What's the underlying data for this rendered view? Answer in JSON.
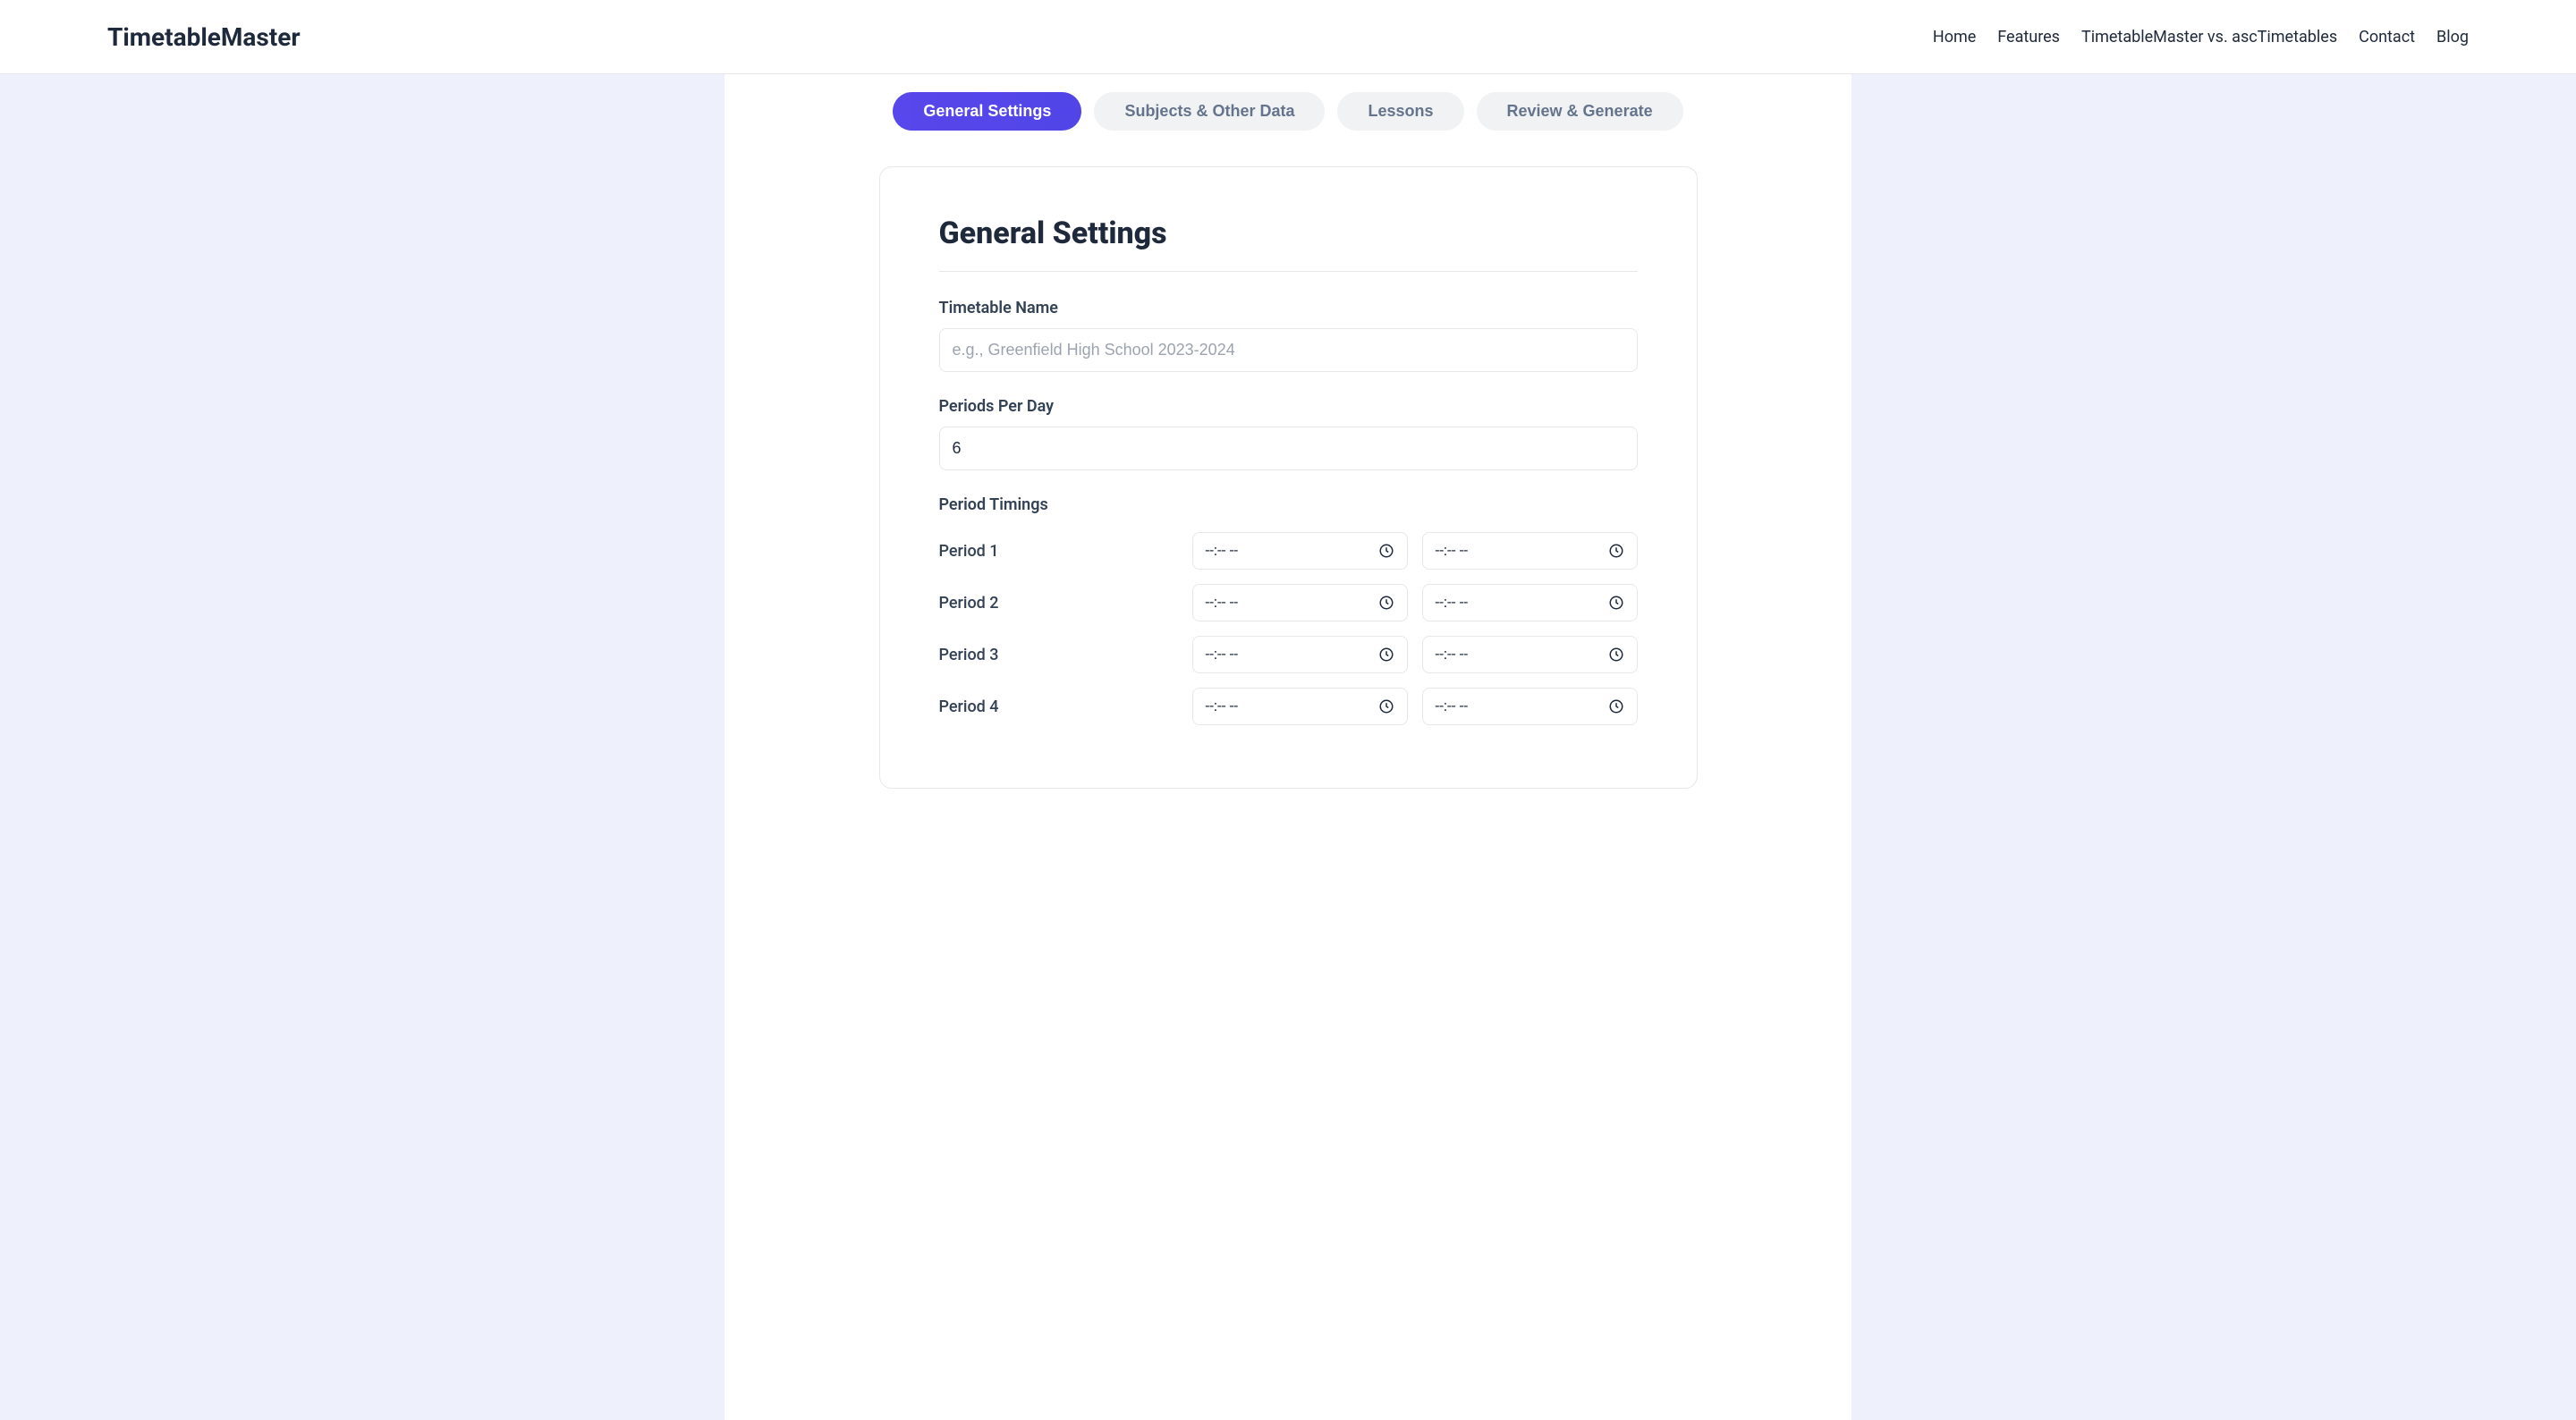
{
  "header": {
    "logo": "TimetableMaster",
    "nav": {
      "home": "Home",
      "features": "Features",
      "compare": "TimetableMaster vs. ascTimetables",
      "contact": "Contact",
      "blog": "Blog"
    }
  },
  "tabs": {
    "general": "General Settings",
    "subjects": "Subjects & Other Data",
    "lessons": "Lessons",
    "review": "Review & Generate"
  },
  "card": {
    "title": "General Settings",
    "timetableName": {
      "label": "Timetable Name",
      "placeholder": "e.g., Greenfield High School 2023-2024",
      "value": ""
    },
    "periodsPerDay": {
      "label": "Periods Per Day",
      "value": "6"
    },
    "periodTimings": {
      "label": "Period Timings",
      "timePlaceholder": "--:--  --",
      "periods": [
        {
          "label": "Period 1"
        },
        {
          "label": "Period 2"
        },
        {
          "label": "Period 3"
        },
        {
          "label": "Period 4"
        }
      ]
    }
  }
}
